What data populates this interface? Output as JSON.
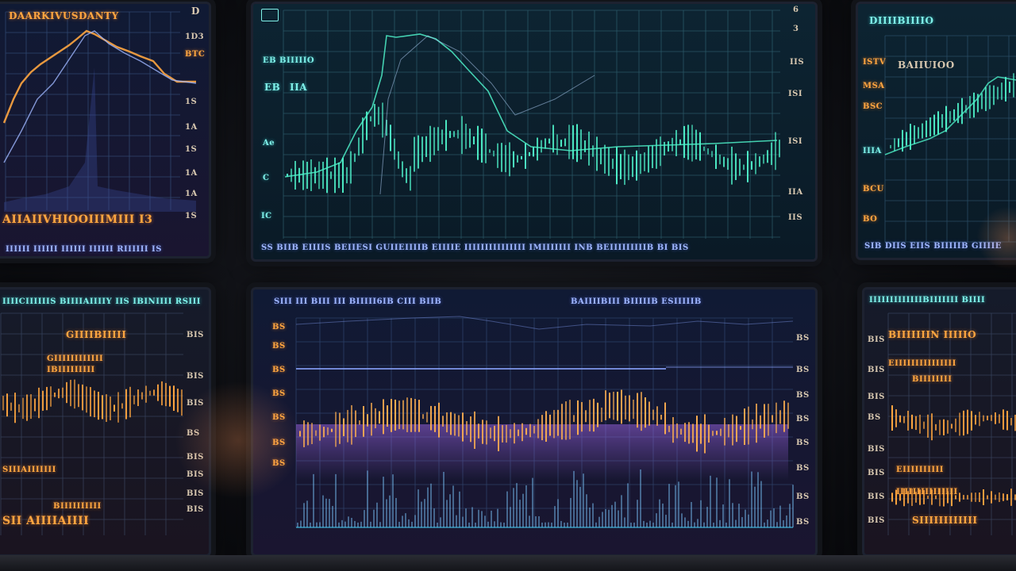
{
  "screens": {
    "top_left": {
      "title": "DAARKIVUSDANTY",
      "corner": "D",
      "ticks": [
        "1D3",
        "BTC",
        "1S",
        "1A",
        "1S",
        "1A",
        "1A",
        "1S"
      ],
      "bottom_line": "AIIAIIVHIOOIIIMIII I3",
      "footer": "IIIIII IIIIII IIIIII IIIIII  RIIIIII IS"
    },
    "top_center": {
      "left_labels": [
        "EB BIIIIIO",
        "EB",
        "IIA",
        "Ae",
        "C",
        "IC"
      ],
      "right_ticks": [
        "6",
        "3",
        "IIS",
        "ISI",
        "ISI",
        "IIA",
        "IIS"
      ],
      "footer": "SS  BIIB  EIIIIS  BEIIESI  GUIIEIIIIB EIIIIE  IIIIIIIIIIIIIII  IMIIIIIII  INB  BEIIIIIIIIIB  BI BIS"
    },
    "top_right": {
      "title": "DIIIIBIIIIO",
      "subtitle": "BAIIUIOO",
      "left_ticks": [
        "ISTV",
        "MSA",
        "BSC",
        "IIIA",
        "BCU",
        "BO"
      ],
      "footer": "SIB  DIIS  EIIS  BIIIIIB  GIIIIE"
    },
    "bottom_left": {
      "title": "IIIICIIIIIIS BIIIIAIIIIY IIS IBINIIII RSIII",
      "labels": [
        "GIIIIBIIIII",
        "GIIIIIIIIIIII",
        "IBIIIIIIIII",
        "SIIIAIIIIIII",
        "BIIIIIIIIII",
        "SII AIIIIAIIII"
      ],
      "right_ticks": [
        "BIS",
        "BIS",
        "BIS",
        "BS",
        "BIS",
        "BIS",
        "BIS",
        "BIS"
      ]
    },
    "bottom_center": {
      "header_left": "SIII III BIII III  BIIIII6IB  CIII BIIB",
      "header_right": "BAIIIIBIII BIIIIIB  ESIIIIIB",
      "left_ticks": [
        "BS",
        "BS",
        "BS",
        "BS",
        "BS",
        "BS",
        "BS"
      ],
      "right_ticks": [
        "BS",
        "BS",
        "BS",
        "BS",
        "BS",
        "BS",
        "BS",
        "BS"
      ]
    },
    "bottom_right": {
      "title": "IIIIIIIIIIIIIBIIIIIII BIIII",
      "subtitle": "BIIIIIIIN IIIIIO",
      "labels": [
        "EIIIIIIIIIIIIIII",
        "BIIIIIIII",
        "EIIIIIIIIII",
        "IIIIIIIIIIIIIII",
        "SIIIIIIIIIIII"
      ],
      "left_ticks": [
        "BIS",
        "BIS",
        "BIS",
        "BS",
        "BIS",
        "BIS",
        "BIS",
        "BIS"
      ]
    }
  },
  "colors": {
    "orange": "#ffa640",
    "cyan": "#4ef0c8",
    "blue": "#8aa4ff",
    "purple": "#b070ff",
    "grid": "#3c5a8a"
  }
}
